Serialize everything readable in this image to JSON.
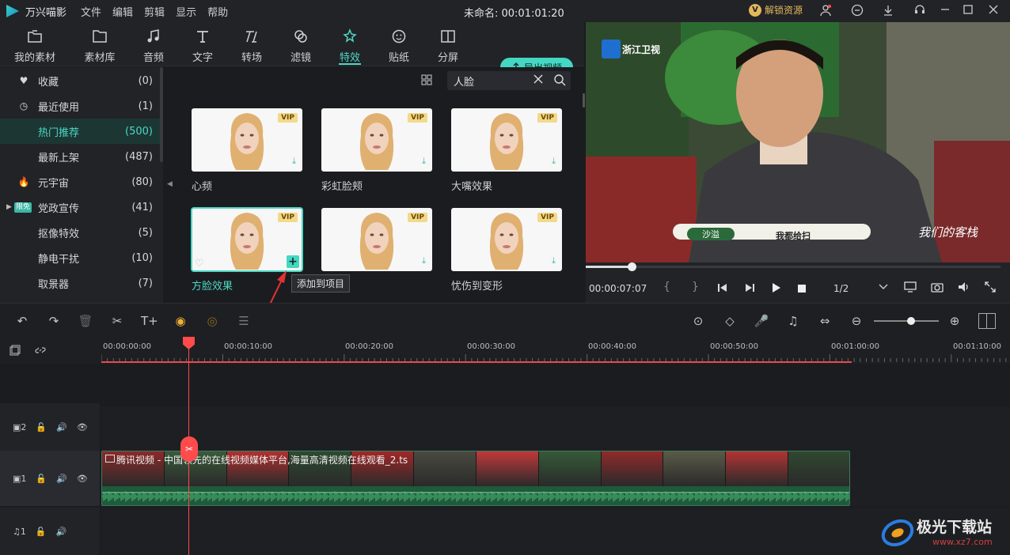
{
  "app": {
    "name": "万兴喵影",
    "project_title": "未命名: 00:01:01:20",
    "unlock_label": "解锁资源"
  },
  "menu": [
    "文件",
    "编辑",
    "剪辑",
    "显示",
    "帮助"
  ],
  "tabs": [
    {
      "label": "我的素材",
      "icon": "folder-icon"
    },
    {
      "label": "素材库",
      "icon": "library-icon"
    },
    {
      "label": "音频",
      "icon": "music-icon"
    },
    {
      "label": "文字",
      "icon": "text-icon"
    },
    {
      "label": "转场",
      "icon": "transition-icon"
    },
    {
      "label": "滤镜",
      "icon": "filter-icon"
    },
    {
      "label": "特效",
      "icon": "effects-icon",
      "active": true
    },
    {
      "label": "贴纸",
      "icon": "sticker-icon"
    },
    {
      "label": "分屏",
      "icon": "split-screen-icon"
    }
  ],
  "export_label": "导出视频",
  "sidebar": {
    "items": [
      {
        "icon": "♥",
        "label": "收藏",
        "count": "(0)"
      },
      {
        "icon": "◷",
        "label": "最近使用",
        "count": "(1)"
      },
      {
        "icon": "",
        "label": "热门推荐",
        "count": "(500)",
        "active": true
      },
      {
        "icon": "",
        "label": "最新上架",
        "count": "(487)"
      },
      {
        "icon": "🔥",
        "label": "元宇宙",
        "count": "(80)"
      },
      {
        "icon": "限免",
        "label": "党政宣传",
        "count": "(41)"
      },
      {
        "icon": "",
        "label": "抠像特效",
        "count": "(5)"
      },
      {
        "icon": "",
        "label": "静电干扰",
        "count": "(10)"
      },
      {
        "icon": "",
        "label": "取景器",
        "count": "(7)"
      }
    ]
  },
  "search": {
    "value": "人脸"
  },
  "effects": [
    {
      "name": "心频",
      "vip": "VIP"
    },
    {
      "name": "彩虹脸颊",
      "vip": "VIP"
    },
    {
      "name": "大嘴效果",
      "vip": "VIP"
    },
    {
      "name": "方脸效果",
      "vip": "VIP",
      "selected": true
    },
    {
      "name": "",
      "vip": "VIP"
    },
    {
      "name": "忧伤到变形",
      "vip": "VIP"
    }
  ],
  "tooltip": "添加到项目",
  "preview": {
    "channel_logo": "浙江卫视",
    "name_tag": "沙溢",
    "caption": "我都给扫",
    "show_logo": "我们的客栈",
    "timecode": "00:00:07:07",
    "progress": 0.11,
    "quality": "1/2"
  },
  "ruler": [
    "00:00:00:00",
    "00:00:10:00",
    "00:00:20:00",
    "00:00:30:00",
    "00:00:40:00",
    "00:00:50:00",
    "00:01:00:00",
    "00:01:10:00"
  ],
  "tracks": [
    {
      "id": "2",
      "type": "video"
    },
    {
      "id": "1",
      "type": "video"
    },
    {
      "id": "1",
      "type": "audio"
    }
  ],
  "clip": {
    "title": "腾讯视频 - 中国领先的在线视频媒体平台,海量高清视频在线观看_2.ts"
  },
  "watermark": {
    "title": "极光下载站",
    "url": "www.xz7.com"
  },
  "colors": {
    "accent": "#44d7c2",
    "playhead": "#ff4b4b",
    "vip": "#f3d98a"
  }
}
